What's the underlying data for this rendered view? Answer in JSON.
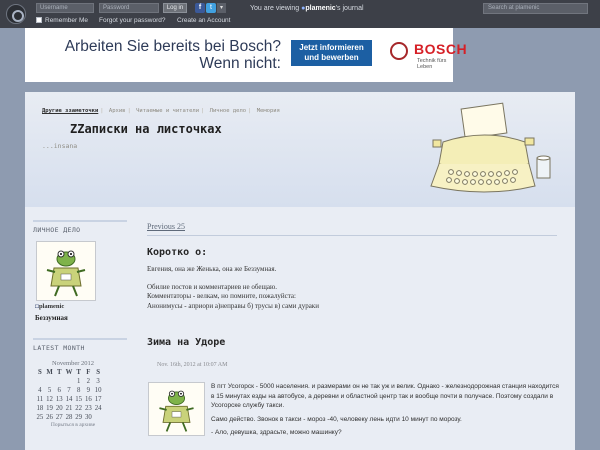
{
  "topbar": {
    "username_placeholder": "Username",
    "password_placeholder": "Password",
    "login_label": "Log in",
    "facebook_glyph": "f",
    "twitter_glyph": "t",
    "dropdown_glyph": "▾",
    "remember_label": "Remember Me",
    "forgot_label": "Forgot your password?",
    "create_label": "Create an Account",
    "viewing_prefix": "You are viewing",
    "viewing_user": "plamenic",
    "viewing_suffix": "'s journal",
    "search_placeholder": "Search at plamenic"
  },
  "ad": {
    "question": "Arbeiten Sie bereits bei Bosch? Wenn nicht:",
    "button": "Jetzt informieren und bewerben",
    "brand": "BOSCH",
    "slogan": "Technik fürs Leben"
  },
  "nav": {
    "items": [
      "Другие ззаметочки",
      "Архив",
      "Читаемые и читатели",
      "Личное дело",
      "Мемория"
    ]
  },
  "journal": {
    "title": "ZZаписки на листочках",
    "subtitle": "...insana"
  },
  "sidebar": {
    "profile_header": "ЛИЧНОЕ ДЕЛО",
    "user": "plamenic",
    "name": "Беззумная",
    "month_header": "LATEST MONTH",
    "calendar_title": "November 2012",
    "weekdays": [
      "S",
      "M",
      "T",
      "W",
      "T",
      "F",
      "S"
    ],
    "weeks": [
      [
        "",
        "",
        "",
        "",
        "1",
        "2",
        "3"
      ],
      [
        "4",
        "5",
        "6",
        "7",
        "8",
        "9",
        "10"
      ],
      [
        "11",
        "12",
        "13",
        "14",
        "15",
        "16",
        "17"
      ],
      [
        "18",
        "19",
        "20",
        "21",
        "22",
        "23",
        "24"
      ],
      [
        "25",
        "26",
        "27",
        "28",
        "29",
        "30",
        ""
      ]
    ],
    "browse": "Порыться в архиве"
  },
  "main": {
    "previous": "Previous 25",
    "about_title": "Коротко о:",
    "about_lines": [
      "Евгения, она же Женька, она же Беззумная.",
      "Обилие постов и комментариев не обещаю.",
      "Комментаторы - велкам, но помните, пожалуйста:",
      "Анонимусы - априори а)неправы б) трусы в) сами дураки"
    ],
    "post_title": "Зима на Удоре",
    "post_date": "Nov. 16th, 2012 at 10:07 AM",
    "post_paragraphs": [
      "В пгт Усогорск - 5000 населения. и размерами он не так уж и велик. Однако - железнодорожная станция находится в 15 минутах езды на автобусе, а деревни и областной центр так и вообще почти в получасе. Поэтому создали в Усогорске службу такси.",
      "Само действо. Звонок в такси - мороз -40, человеку лень идти 10 минут по морозу.",
      "- Ало, девушка, здрасьте, можно машинку?"
    ]
  }
}
